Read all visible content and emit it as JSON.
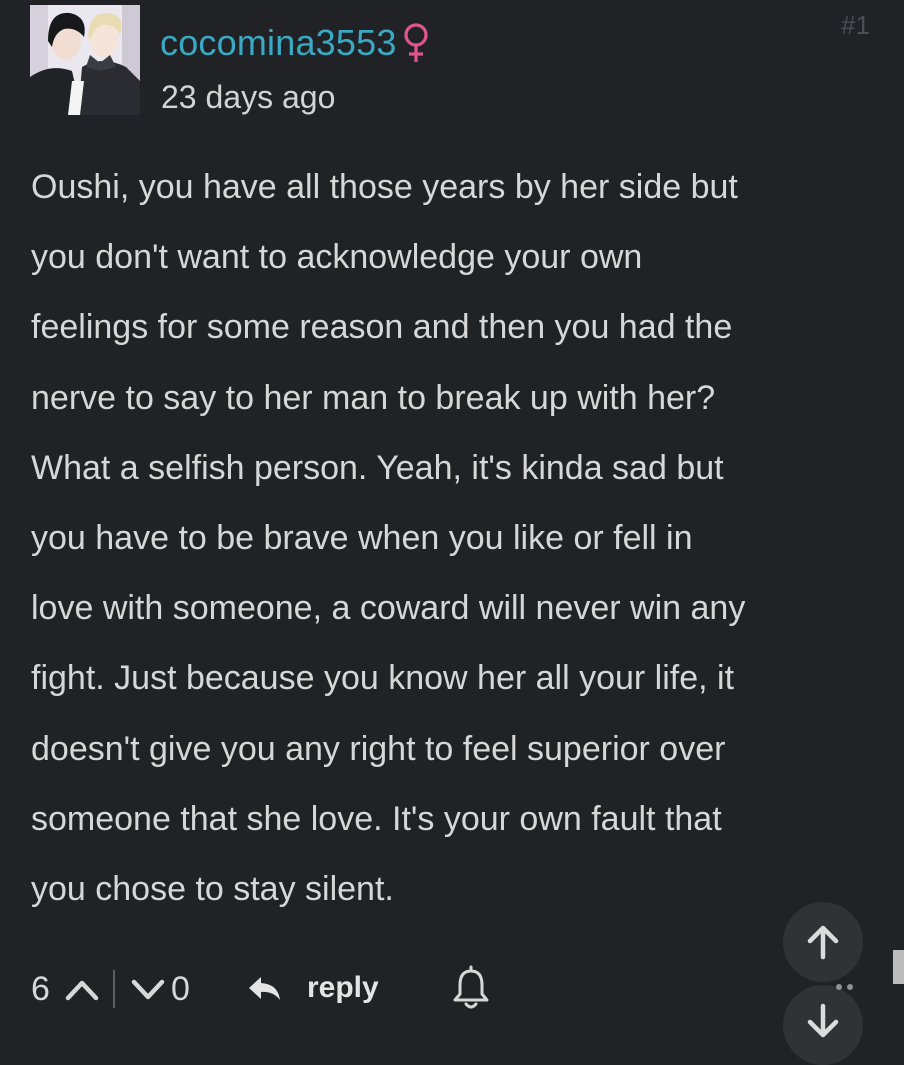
{
  "comment": {
    "username": "cocomina3553",
    "gender_icon": "female-symbol-icon",
    "timestamp": "23 days ago",
    "number": "#1",
    "body_lines": [
      "Oushi, you have all those years by her side but",
      "you don't want to acknowledge your own",
      "feelings for some reason and then you had the",
      "nerve to say to her man to break up with her?",
      "What a selfish person. Yeah, it's kinda sad but",
      "you have to be brave when you like or fell in",
      "love with someone, a coward will never win any",
      "fight. Just because you know her all your life, it",
      "doesn't give you any right to feel superior over",
      "someone that she love. It's your own fault that",
      "you chose to stay silent."
    ]
  },
  "footer": {
    "upvotes": "6",
    "downvotes": "0",
    "reply_label": "reply"
  },
  "colors": {
    "background": "#212226",
    "username": "#3aa9c3",
    "gender_icon": "#e0558d",
    "text": "#d7d7d7",
    "muted": "#4c4e54"
  },
  "icons": {
    "upvote": "chevron-up-icon",
    "downvote": "chevron-down-icon",
    "reply": "reply-arrow-icon",
    "notify": "bell-icon",
    "scroll_up": "arrow-up-icon",
    "scroll_down": "arrow-down-icon"
  }
}
